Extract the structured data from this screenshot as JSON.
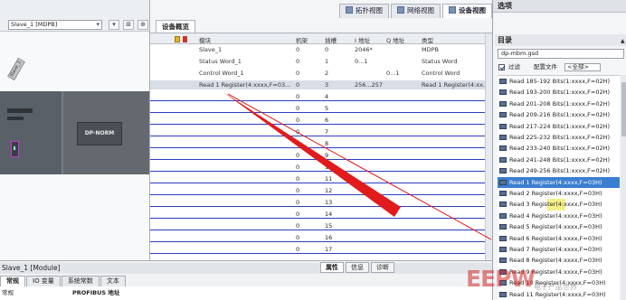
{
  "left_pane": {
    "device_select": "Slave_1 [MDPB]",
    "rack_tag": "Slave_1",
    "module_label": "DP-NORM"
  },
  "view_tabs": [
    {
      "label": "拓扑视图",
      "active": false
    },
    {
      "label": "网络视图",
      "active": false
    },
    {
      "label": "设备视图",
      "active": true
    }
  ],
  "overview_tab": "设备概览",
  "table": {
    "headers": {
      "module": "模块",
      "rack": "机架",
      "slot": "插槽",
      "iaddr": "I 地址",
      "qaddr": "Q 地址",
      "type": "类型"
    },
    "rows": [
      {
        "module": "Slave_1",
        "rack": "0",
        "slot": "0",
        "iaddr": "2046*",
        "qaddr": "",
        "type": "MDPB"
      },
      {
        "module": "Status Word_1",
        "rack": "0",
        "slot": "1",
        "iaddr": "0...1",
        "qaddr": "",
        "type": "Status Word"
      },
      {
        "module": "Control Word_1",
        "rack": "0",
        "slot": "2",
        "iaddr": "",
        "qaddr": "0...1",
        "type": "Control Word"
      },
      {
        "module": "Read 1 Register(4:xxxx,F=03...",
        "rack": "0",
        "slot": "3",
        "iaddr": "256...257",
        "qaddr": "",
        "type": "Read 1 Register(4:xx..."
      },
      {
        "module": "",
        "rack": "0",
        "slot": "4",
        "iaddr": "",
        "qaddr": "",
        "type": ""
      },
      {
        "module": "",
        "rack": "0",
        "slot": "5",
        "iaddr": "",
        "qaddr": "",
        "type": ""
      },
      {
        "module": "",
        "rack": "0",
        "slot": "6",
        "iaddr": "",
        "qaddr": "",
        "type": ""
      },
      {
        "module": "",
        "rack": "0",
        "slot": "7",
        "iaddr": "",
        "qaddr": "",
        "type": ""
      },
      {
        "module": "",
        "rack": "0",
        "slot": "8",
        "iaddr": "",
        "qaddr": "",
        "type": ""
      },
      {
        "module": "",
        "rack": "0",
        "slot": "9",
        "iaddr": "",
        "qaddr": "",
        "type": ""
      },
      {
        "module": "",
        "rack": "0",
        "slot": "10",
        "iaddr": "",
        "qaddr": "",
        "type": ""
      },
      {
        "module": "",
        "rack": "0",
        "slot": "11",
        "iaddr": "",
        "qaddr": "",
        "type": ""
      },
      {
        "module": "",
        "rack": "0",
        "slot": "12",
        "iaddr": "",
        "qaddr": "",
        "type": ""
      },
      {
        "module": "",
        "rack": "0",
        "slot": "13",
        "iaddr": "",
        "qaddr": "",
        "type": ""
      },
      {
        "module": "",
        "rack": "0",
        "slot": "14",
        "iaddr": "",
        "qaddr": "",
        "type": ""
      },
      {
        "module": "",
        "rack": "0",
        "slot": "15",
        "iaddr": "",
        "qaddr": "",
        "type": ""
      },
      {
        "module": "",
        "rack": "0",
        "slot": "16",
        "iaddr": "",
        "qaddr": "",
        "type": ""
      },
      {
        "module": "",
        "rack": "0",
        "slot": "17",
        "iaddr": "",
        "qaddr": "",
        "type": ""
      }
    ]
  },
  "properties": {
    "title": "Slave_1 [Module]",
    "right_tabs": [
      "属性",
      "信息",
      "诊断"
    ],
    "tabs": [
      "常规",
      "IO 变量",
      "系统常数",
      "文本"
    ],
    "nav_item": "常规",
    "section": "PROFIBUS 地址"
  },
  "options_pane": {
    "title": "选项",
    "catalog_title": "目录",
    "gsd_field": "dp-mbm.gsd",
    "filter_label": "过滤",
    "profile_label": "配置文件",
    "profile_value": "<全部>",
    "items": [
      {
        "label": "Read 185-192 Bits(1:xxxx,F=02H)",
        "state": "normal"
      },
      {
        "label": "Read 193-200 Bits(1:xxxx,F=02H)",
        "state": "normal"
      },
      {
        "label": "Read 201-208 Bits(1:xxxx,F=02H)",
        "state": "normal"
      },
      {
        "label": "Read 209-216 Bits(1:xxxx,F=02H)",
        "state": "normal"
      },
      {
        "label": "Read 217-224 Bits(1:xxxx,F=02H)",
        "state": "normal"
      },
      {
        "label": "Read 225-232 Bits(1:xxxx,F=02H)",
        "state": "normal"
      },
      {
        "label": "Read 233-240 Bits(1:xxxx,F=02H)",
        "state": "normal"
      },
      {
        "label": "Read 241-248 Bits(1:xxxx,F=02H)",
        "state": "normal"
      },
      {
        "label": "Read 249-256 Bits(1:xxxx,F=02H)",
        "state": "normal"
      },
      {
        "label": "Read 1 Register(4:xxxx,F=03H)",
        "state": "selected"
      },
      {
        "label": "Read 2 Register(4:xxxx,F=03H)",
        "state": "normal"
      },
      {
        "label": "Read 3 Register(4:xxxx,F=03H)",
        "state": "highlight"
      },
      {
        "label": "Read 4 Register(4:xxxx,F=03H)",
        "state": "normal"
      },
      {
        "label": "Read 5 Register(4:xxxx,F=03H)",
        "state": "normal"
      },
      {
        "label": "Read 6 Register(4:xxxx,F=03H)",
        "state": "normal"
      },
      {
        "label": "Read 7 Register(4:xxxx,F=03H)",
        "state": "normal"
      },
      {
        "label": "Read 8 Register(4:xxxx,F=03H)",
        "state": "normal"
      },
      {
        "label": "Read 9 Register(4:xxxx,F=03H)",
        "state": "normal"
      },
      {
        "label": "Read 10 Register(4:xxxx,F=03H)",
        "state": "normal"
      },
      {
        "label": "Read 11 Register(4:xxxx,F=03H)",
        "state": "normal"
      }
    ]
  },
  "watermark": {
    "text": "EEPW",
    "sub": "电子产品世界"
  },
  "colors": {
    "accent": "#3b7ed0",
    "arrow": "#e11b1b",
    "empty_row_line": "#2a3dc4"
  }
}
